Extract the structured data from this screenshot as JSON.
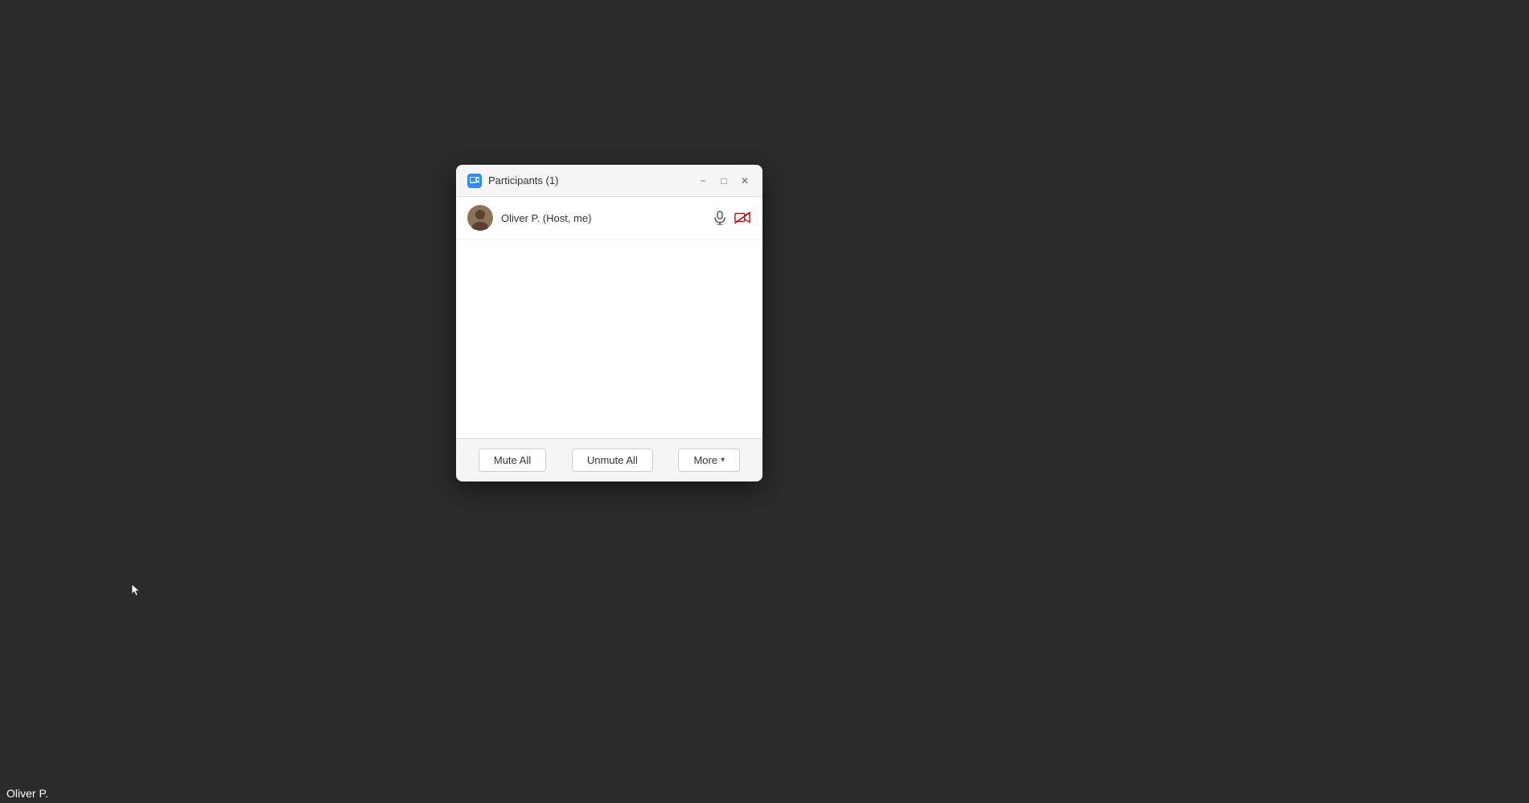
{
  "background": {
    "color": "#2b2b2b"
  },
  "bottom_label": {
    "text": "Oliver P."
  },
  "dialog": {
    "title": "Participants (1)",
    "window_controls": {
      "minimize": "−",
      "maximize": "□",
      "close": "✕"
    },
    "participants": [
      {
        "name": "Oliver P. (Host, me)",
        "is_host": true,
        "is_me": true,
        "mic_active": true,
        "video_active": false
      }
    ],
    "footer_buttons": {
      "mute_all": "Mute All",
      "unmute_all": "Unmute All",
      "more": "More"
    }
  }
}
